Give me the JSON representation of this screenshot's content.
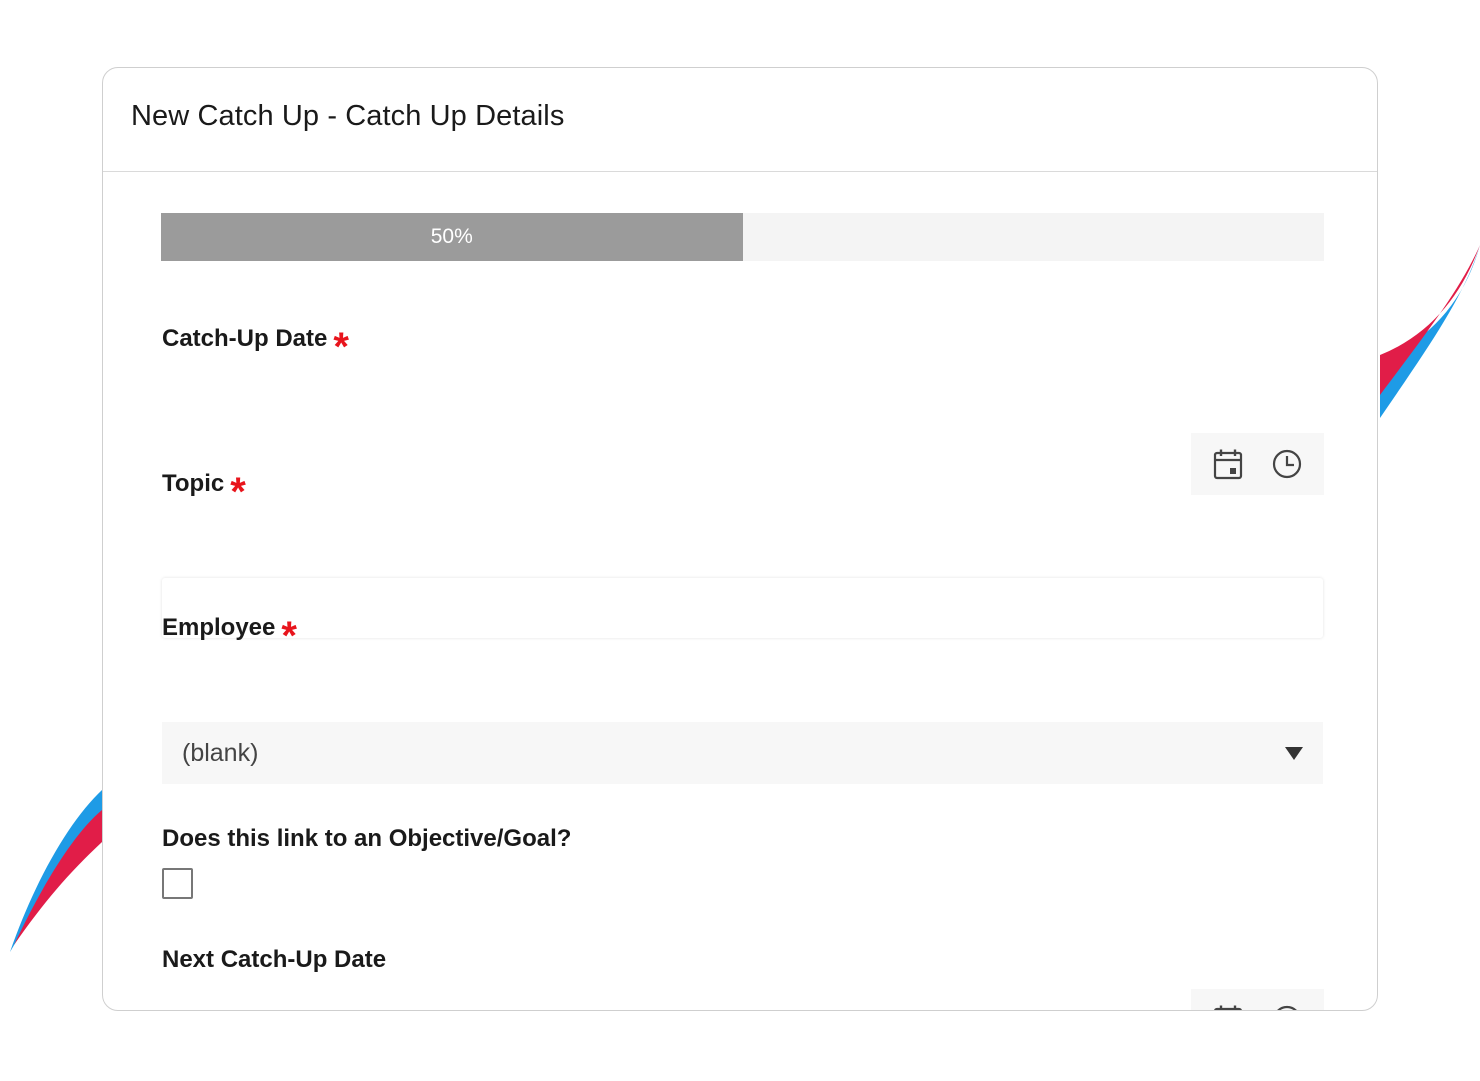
{
  "header": {
    "title": "New Catch Up - Catch Up Details"
  },
  "progress": {
    "percent": 50,
    "label": "50%"
  },
  "fields": {
    "catchup_date": {
      "label": "Catch-Up Date",
      "required_mark": "*"
    },
    "topic": {
      "label": "Topic",
      "required_mark": "*",
      "value": ""
    },
    "employee": {
      "label": "Employee",
      "required_mark": "*",
      "selected": "(blank)"
    },
    "objective_link": {
      "label": "Does this link to an Objective/Goal?",
      "checked": false
    },
    "next_catchup_date": {
      "label": "Next Catch-Up Date"
    }
  },
  "icons": {
    "date": "calendar-icon",
    "time": "clock-icon",
    "dropdown": "caret-down-icon"
  },
  "colors": {
    "accent_red": "#e8141c",
    "swoosh_red": "#e11d48",
    "swoosh_blue": "#1e9be6",
    "progress_fill": "#9b9b9b",
    "progress_track": "#f4f4f4"
  }
}
